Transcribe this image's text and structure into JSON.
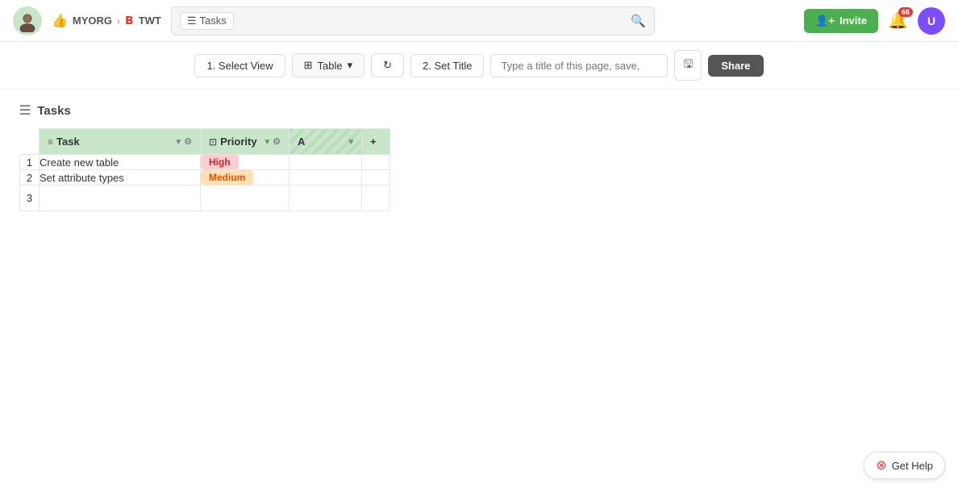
{
  "nav": {
    "org_name": "MYORG",
    "project_name": "TWT",
    "search_badge_label": "Tasks",
    "search_placeholder": "",
    "invite_label": "Invite",
    "notification_count": "66"
  },
  "toolbar": {
    "step1_label": "1. Select View",
    "table_label": "Table",
    "step2_label": "2. Set Title",
    "title_placeholder": "Type a title of this page, save,",
    "share_label": "Share"
  },
  "table": {
    "title": "Tasks",
    "columns": [
      {
        "key": "task",
        "label": "Task"
      },
      {
        "key": "priority",
        "label": "Priority"
      },
      {
        "key": "a",
        "label": "A"
      }
    ],
    "rows": [
      {
        "num": "1",
        "task": "Create new table",
        "priority": "High",
        "priority_type": "high"
      },
      {
        "num": "2",
        "task": "Set attribute types",
        "priority": "Medium",
        "priority_type": "medium"
      },
      {
        "num": "3",
        "task": "",
        "priority": "",
        "priority_type": ""
      }
    ]
  },
  "help": {
    "label": "Get Help"
  }
}
